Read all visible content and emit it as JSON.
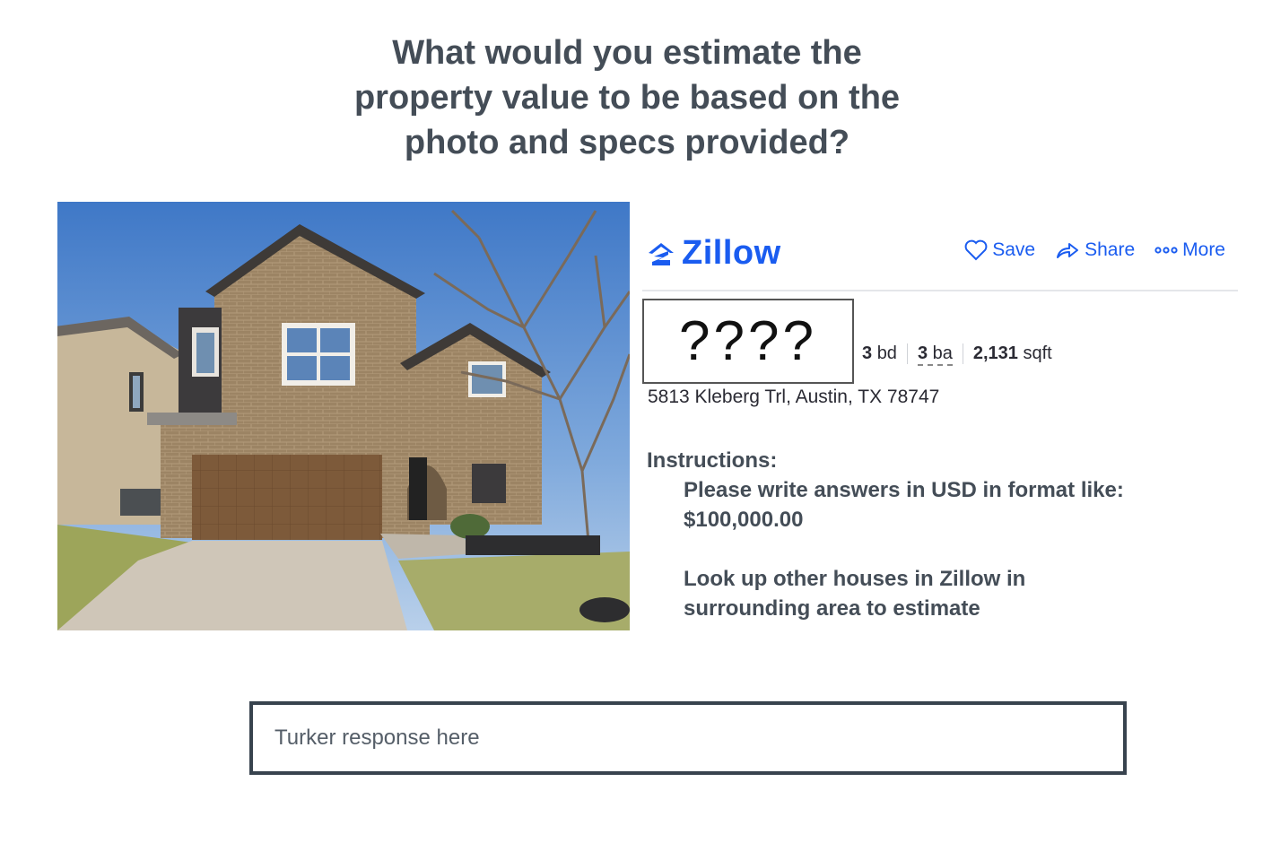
{
  "question": {
    "line1": "What would you estimate the",
    "line2": "property value to be based on the",
    "line3": "photo and specs provided?"
  },
  "photo": {
    "subject": "house-exterior-photo"
  },
  "zillow": {
    "logo_text": "Zillow",
    "actions": {
      "save": "Save",
      "share": "Share",
      "more": "More"
    },
    "price_hidden": "????",
    "specs": {
      "beds_num": "3",
      "beds_unit": "bd",
      "baths_num": "3",
      "baths_unit": "ba",
      "sqft_num": "2,131",
      "sqft_unit": "sqft"
    },
    "address": "5813 Kleberg Trl, Austin, TX 78747",
    "colors": {
      "brand": "#1a5cf0"
    }
  },
  "instructions": {
    "label": "Instructions:",
    "line1": "Please write answers in USD in format like:",
    "line2": "$100,000.00",
    "line3": "Look up other houses in Zillow in",
    "line4": "surrounding area to estimate"
  },
  "response": {
    "placeholder": "Turker response here",
    "value": ""
  }
}
